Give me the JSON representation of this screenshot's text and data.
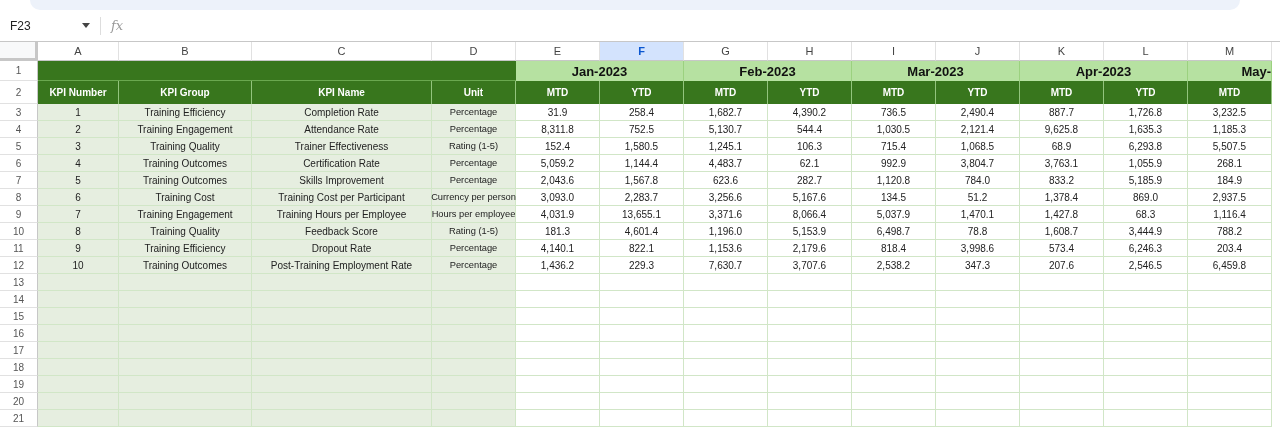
{
  "name_box": {
    "value": "F23"
  },
  "formula_bar": {
    "label": "fx"
  },
  "columns": [
    {
      "label": "A",
      "selected": false
    },
    {
      "label": "B",
      "selected": false
    },
    {
      "label": "C",
      "selected": false
    },
    {
      "label": "D",
      "selected": false
    },
    {
      "label": "E",
      "selected": false
    },
    {
      "label": "F",
      "selected": true
    },
    {
      "label": "G",
      "selected": false
    },
    {
      "label": "H",
      "selected": false
    },
    {
      "label": "I",
      "selected": false
    },
    {
      "label": "J",
      "selected": false
    },
    {
      "label": "K",
      "selected": false
    },
    {
      "label": "L",
      "selected": false
    },
    {
      "label": "M",
      "selected": false
    }
  ],
  "row_numbers": [
    "1",
    "2",
    "3",
    "4",
    "5",
    "6",
    "7",
    "8",
    "9",
    "10",
    "11",
    "12",
    "13",
    "14",
    "15",
    "16",
    "17",
    "18",
    "19",
    "20",
    "21"
  ],
  "month_headers": [
    "Jan-2023",
    "Feb-2023",
    "Mar-2023",
    "Apr-2023",
    "May-"
  ],
  "subheaders": [
    "KPI Number",
    "KPI Group",
    "KPI Name",
    "Unit",
    "MTD",
    "YTD",
    "MTD",
    "YTD",
    "MTD",
    "YTD",
    "MTD",
    "YTD",
    "MTD"
  ],
  "rows": [
    {
      "cells": [
        "1",
        "Training Efficiency",
        "Completion Rate",
        "Percentage",
        "31.9",
        "258.4",
        "1,682.7",
        "4,390.2",
        "736.5",
        "2,490.4",
        "887.7",
        "1,726.8",
        "3,232.5"
      ]
    },
    {
      "cells": [
        "2",
        "Training Engagement",
        "Attendance Rate",
        "Percentage",
        "8,311.8",
        "752.5",
        "5,130.7",
        "544.4",
        "1,030.5",
        "2,121.4",
        "9,625.8",
        "1,635.3",
        "1,185.3"
      ]
    },
    {
      "cells": [
        "3",
        "Training Quality",
        "Trainer Effectiveness",
        "Rating (1-5)",
        "152.4",
        "1,580.5",
        "1,245.1",
        "106.3",
        "715.4",
        "1,068.5",
        "68.9",
        "6,293.8",
        "5,507.5"
      ]
    },
    {
      "cells": [
        "4",
        "Training Outcomes",
        "Certification Rate",
        "Percentage",
        "5,059.2",
        "1,144.4",
        "4,483.7",
        "62.1",
        "992.9",
        "3,804.7",
        "3,763.1",
        "1,055.9",
        "268.1"
      ]
    },
    {
      "cells": [
        "5",
        "Training Outcomes",
        "Skills Improvement",
        "Percentage",
        "2,043.6",
        "1,567.8",
        "623.6",
        "282.7",
        "1,120.8",
        "784.0",
        "833.2",
        "5,185.9",
        "184.9"
      ]
    },
    {
      "cells": [
        "6",
        "Training Cost",
        "Training Cost per Participant",
        "Currency per person",
        "3,093.0",
        "2,283.7",
        "3,256.6",
        "5,167.6",
        "134.5",
        "51.2",
        "1,378.4",
        "869.0",
        "2,937.5"
      ]
    },
    {
      "cells": [
        "7",
        "Training Engagement",
        "Training Hours per Employee",
        "Hours per employee",
        "4,031.9",
        "13,655.1",
        "3,371.6",
        "8,066.4",
        "5,037.9",
        "1,470.1",
        "1,427.8",
        "68.3",
        "1,116.4"
      ]
    },
    {
      "cells": [
        "8",
        "Training Quality",
        "Feedback Score",
        "Rating (1-5)",
        "181.3",
        "4,601.4",
        "1,196.0",
        "5,153.9",
        "6,498.7",
        "78.8",
        "1,608.7",
        "3,444.9",
        "788.2"
      ]
    },
    {
      "cells": [
        "9",
        "Training Efficiency",
        "Dropout Rate",
        "Percentage",
        "4,140.1",
        "822.1",
        "1,153.6",
        "2,179.6",
        "818.4",
        "3,998.6",
        "573.4",
        "6,246.3",
        "203.4"
      ]
    },
    {
      "cells": [
        "10",
        "Training Outcomes",
        "Post-Training Employment Rate",
        "Percentage",
        "1,436.2",
        "229.3",
        "7,630.7",
        "3,707.6",
        "2,538.2",
        "347.3",
        "207.6",
        "2,546.5",
        "6,459.8"
      ]
    }
  ]
}
